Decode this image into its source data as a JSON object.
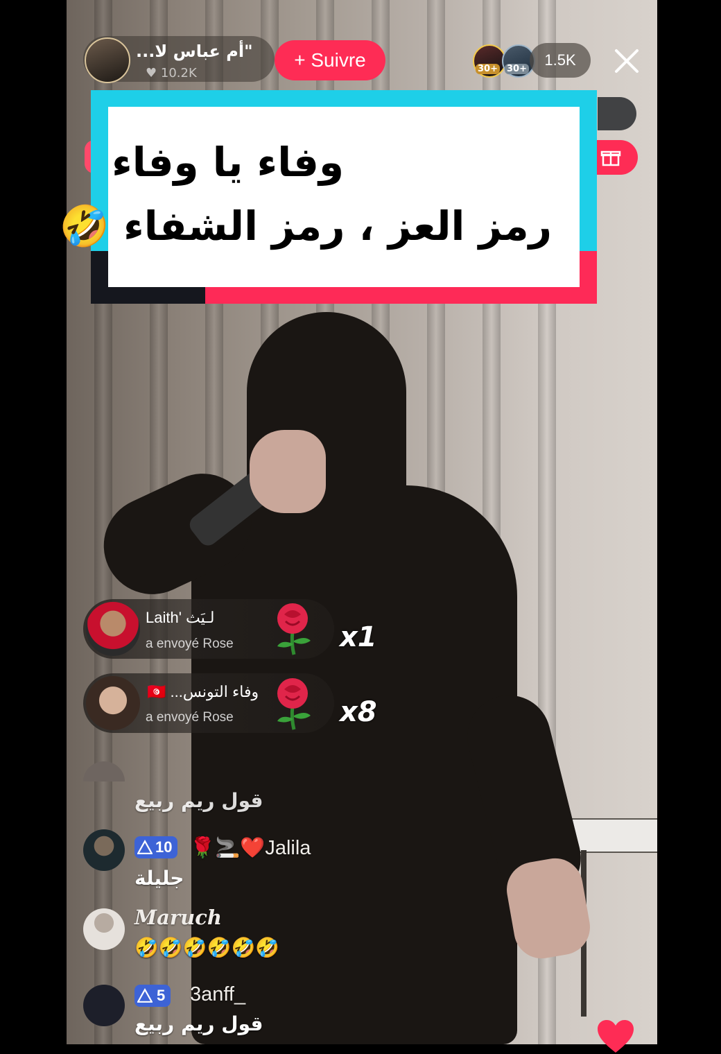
{
  "host": {
    "name": "\"أم عباس لا...",
    "likes": "10.2K",
    "follow_label": "+ Suivre"
  },
  "viewers": {
    "badge_1": "30+",
    "badge_2": "30+",
    "count": "1.5K"
  },
  "caption": {
    "line1": "وفاء يا وفاء",
    "line2": "رمز العز ، رمز الشفاء 🤣"
  },
  "gifts": [
    {
      "user": "Laith' لـيَث",
      "action": "a envoyé  Rose",
      "count": "x1"
    },
    {
      "user": "وفاء التونس... 🇹🇳",
      "action": "a envoyé  Rose",
      "count": "x8"
    }
  ],
  "comments": [
    {
      "name": "",
      "text": "قول ريم ربيع"
    },
    {
      "name": "Jalila",
      "emoji": "🌹🚬❤️",
      "level": "10",
      "text": "جليلة"
    },
    {
      "name": "Maruch",
      "text": "🤣🤣🤣🤣🤣🤣"
    },
    {
      "name": "3anff_",
      "level": "5",
      "text": "قول ريم ربيع"
    }
  ],
  "colors": {
    "accent": "#fe2c55",
    "cyan": "#1ecfe8",
    "level_badge": "#3d63d6"
  }
}
